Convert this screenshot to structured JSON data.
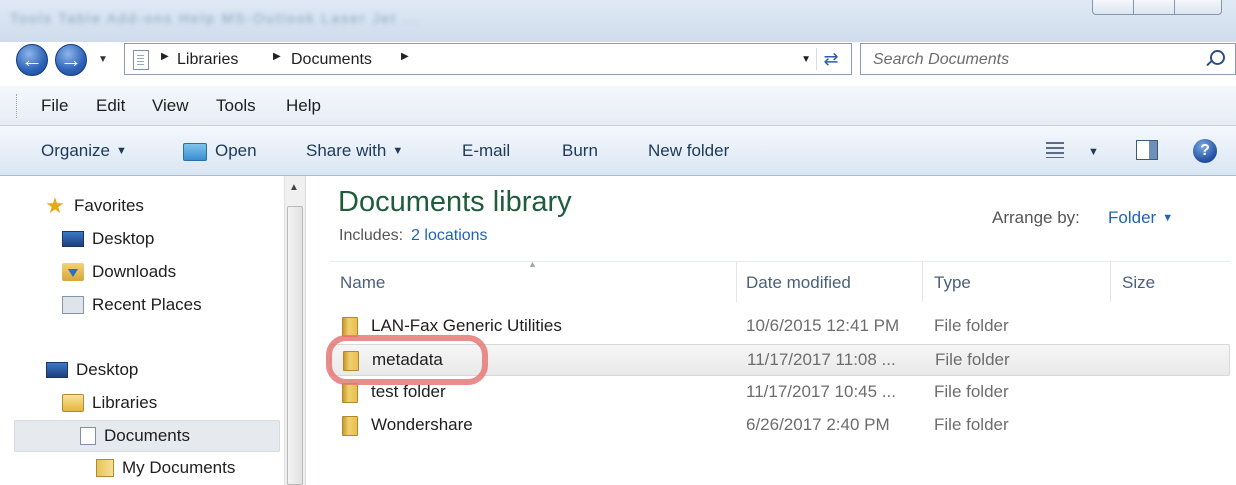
{
  "titlebar": {
    "blurred_text": "Tools   Table   Add-ons   Help          MS-Outlook Laser Jet ..."
  },
  "address": {
    "crumbs": [
      "Libraries",
      "Documents"
    ],
    "search_placeholder": "Search Documents"
  },
  "menu": [
    "File",
    "Edit",
    "View",
    "Tools",
    "Help"
  ],
  "commands": {
    "organize": "Organize",
    "open": "Open",
    "share_with": "Share with",
    "email": "E-mail",
    "burn": "Burn",
    "new_folder": "New folder"
  },
  "nav": {
    "favorites": "Favorites",
    "fav_desktop": "Desktop",
    "downloads": "Downloads",
    "recent_places": "Recent Places",
    "desktop": "Desktop",
    "libraries": "Libraries",
    "documents": "Documents",
    "my_documents": "My Documents"
  },
  "content": {
    "title": "Documents library",
    "includes_label": "Includes:",
    "includes_link": "2 locations",
    "arrange_label": "Arrange by:",
    "arrange_value": "Folder",
    "columns": {
      "name": "Name",
      "date": "Date modified",
      "type": "Type",
      "size": "Size"
    },
    "files": [
      {
        "name": "LAN-Fax Generic Utilities",
        "date": "10/6/2015 12:41 PM",
        "type": "File folder"
      },
      {
        "name": "metadata",
        "date": "11/17/2017 11:08 ...",
        "type": "File folder"
      },
      {
        "name": "test folder",
        "date": "11/17/2017 10:45 ...",
        "type": "File folder"
      },
      {
        "name": "Wondershare",
        "date": "6/26/2017 2:40 PM",
        "type": "File folder"
      }
    ]
  },
  "colors": {
    "title_green": "#1e5c3c",
    "link_blue": "#1e64b4",
    "highlight_ring": "#e47878"
  }
}
